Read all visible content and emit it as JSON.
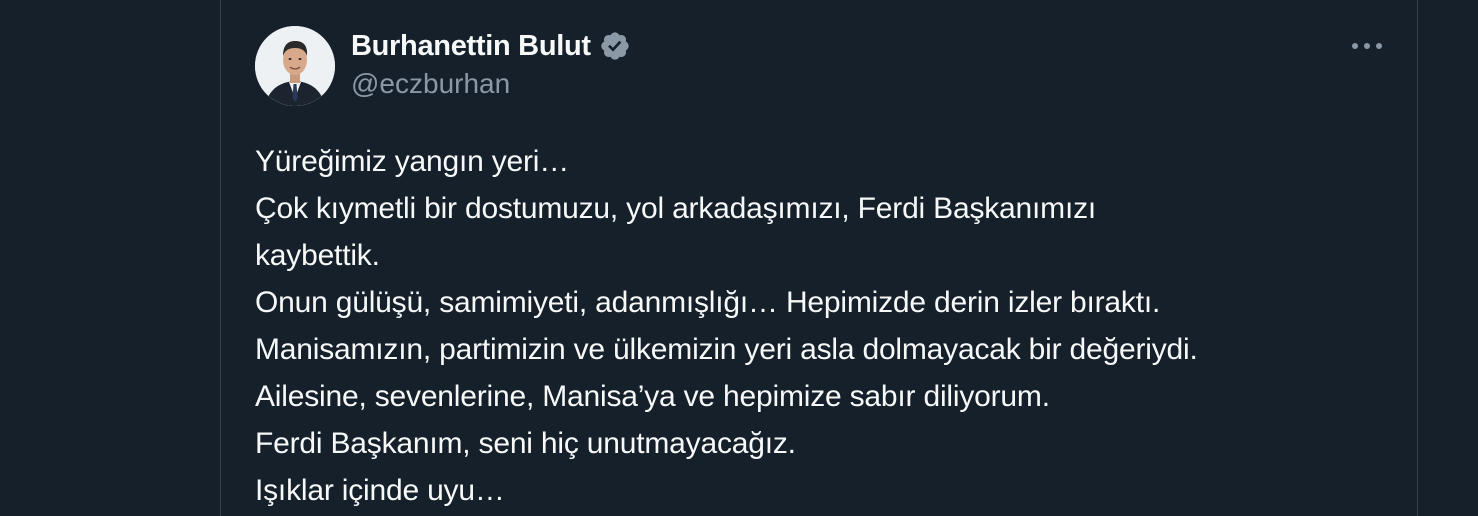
{
  "author": {
    "display_name": "Burhanettin Bulut",
    "handle": "@eczburhan",
    "verified": true,
    "avatar_icon": "profile-photo"
  },
  "menu": {
    "icon": "more-horizontal-icon"
  },
  "tweet": {
    "lines": [
      "Yüreğimiz yangın yeri…",
      "Çok kıymetli bir dostumuzu, yol arkadaşımızı, Ferdi Başkanımızı",
      "kaybettik.",
      "Onun gülüşü, samimiyeti, adanmışlığı… Hepimizde derin izler bıraktı.",
      "Manisamızın, partimizin ve ülkemizin yeri asla dolmayacak bir değeriydi.",
      "Ailesine, sevenlerine, Manisa’ya ve hepimize sabır diliyorum.",
      "Ferdi Başkanım, seni hiç unutmayacağız.",
      "Işıklar içinde uyu…"
    ]
  },
  "colors": {
    "background": "#15202b",
    "text_primary": "#f7f9f9",
    "text_secondary": "#8b98a5",
    "border": "#38444d",
    "verified_badge": "#8b98a5"
  }
}
